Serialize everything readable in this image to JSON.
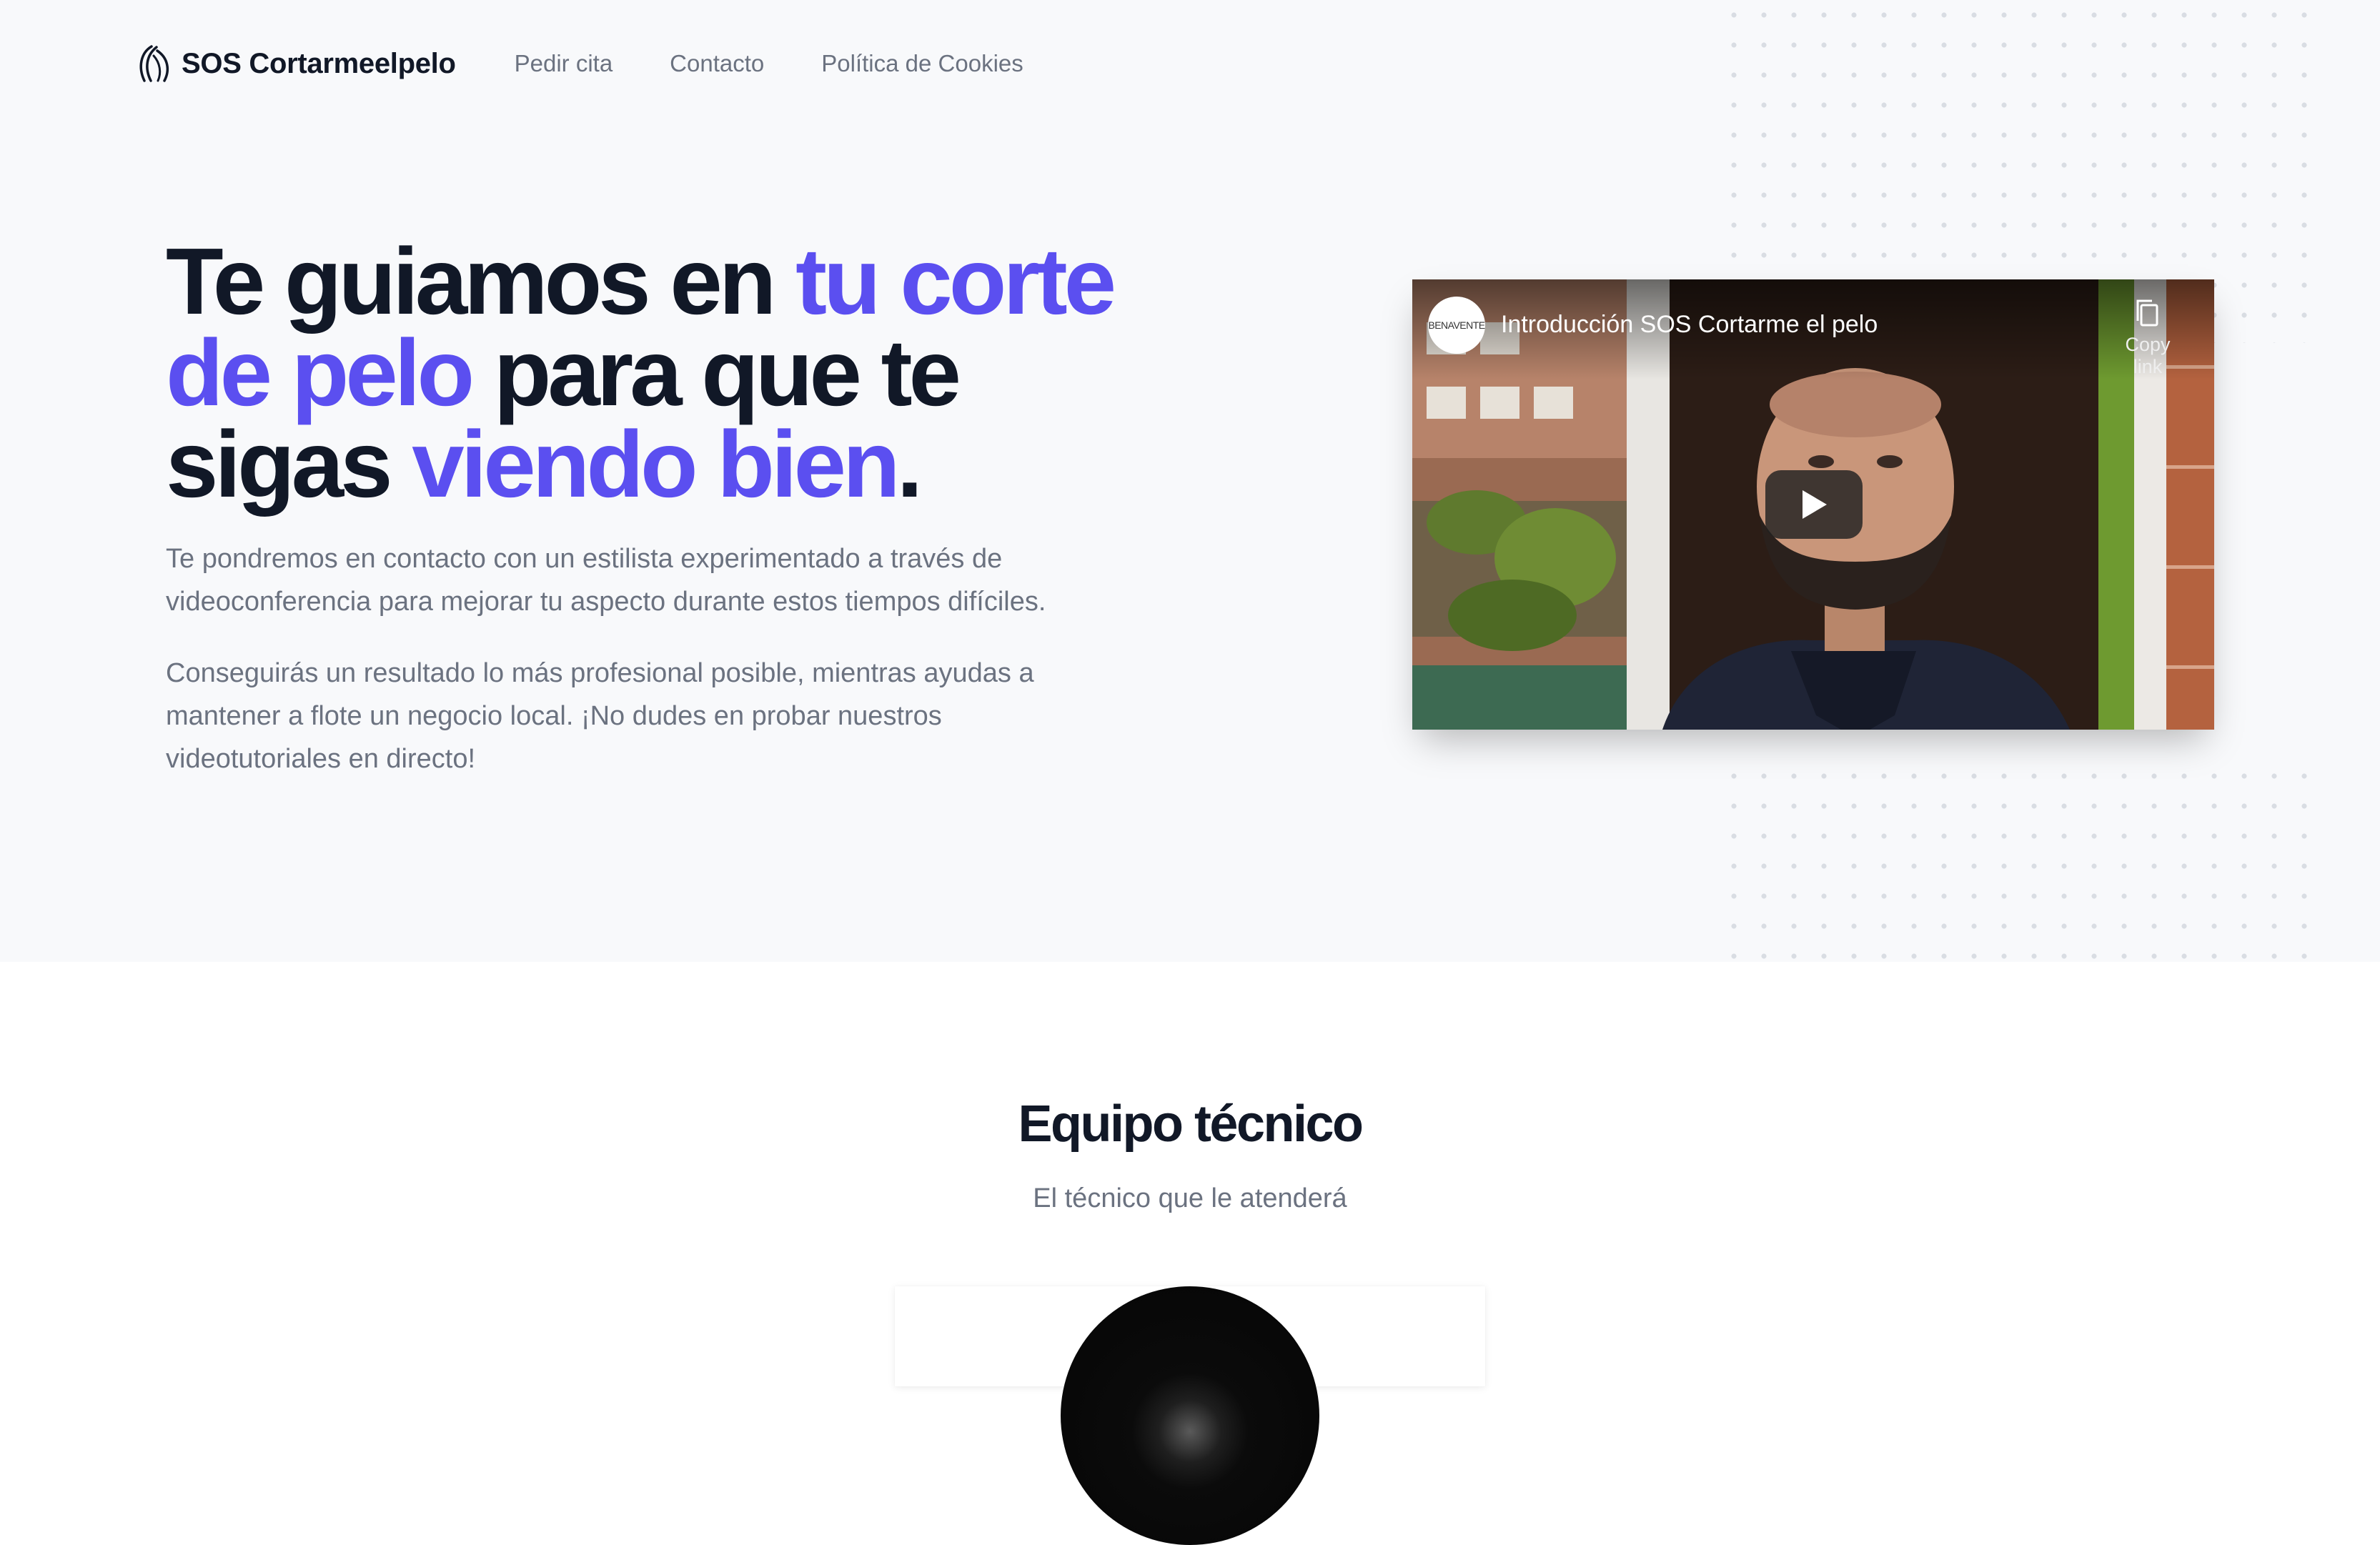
{
  "nav": {
    "brand": "SOS Cortarmeelpelo",
    "brand_icon": "hair-strands-icon",
    "links": [
      "Pedir cita",
      "Contacto",
      "Política de Cookies"
    ]
  },
  "hero": {
    "headline": {
      "part1": "Te guiamos en ",
      "accent1": "tu corte de pelo",
      "part2": " para que te sigas ",
      "accent2": "viendo bien",
      "part3": "."
    },
    "paragraph1": "Te pondremos en contacto con un estilista experimentado a través de videoconferencia para mejorar tu aspecto durante estos tiempos difíciles.",
    "paragraph2": "Conseguirás un resultado lo más profesional posible, mientras ayudas a mantener a flote un negocio local. ¡No dudes en probar nuestros videotutoriales en directo!",
    "accent_color": "#5b4ff0"
  },
  "video": {
    "title": "Introducción SOS Cortarme el pelo",
    "channel_label": "BENAVENTE",
    "copy_link_label": "Copy link",
    "copy_icon": "copy-icon",
    "play_icon": "play-icon"
  },
  "team": {
    "title": "Equipo técnico",
    "subtitle": "El técnico que le atenderá"
  }
}
